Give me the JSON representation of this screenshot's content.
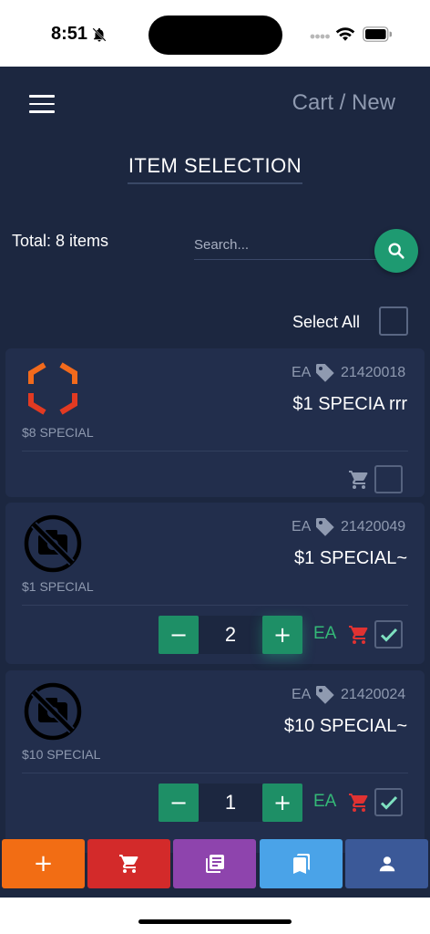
{
  "status_bar": {
    "time": "8:51"
  },
  "header": {
    "breadcrumb": "Cart / New",
    "title": "ITEM SELECTION"
  },
  "toolbar": {
    "total_text": "Total: 8 items",
    "search_placeholder": "Search...",
    "select_all_label": "Select All"
  },
  "items": [
    {
      "sub_label": "$8 SPECIAL",
      "uom": "EA",
      "sku": "21420018",
      "name": "$1 SPECIA rrr",
      "selected": false
    },
    {
      "sub_label": "$1 SPECIAL",
      "uom": "EA",
      "sku": "21420049",
      "name": "$1 SPECIAL~",
      "selected": true,
      "quantity": "2",
      "qty_uom": "EA",
      "minus_label": "−",
      "plus_label": "+"
    },
    {
      "sub_label": "$10 SPECIAL",
      "uom": "EA",
      "sku": "21420024",
      "name": "$10 SPECIAL~",
      "selected": true,
      "quantity": "1",
      "qty_uom": "EA",
      "minus_label": "−",
      "plus_label": "+"
    }
  ],
  "bottom_nav": {
    "add_label": "+"
  },
  "colors": {
    "background": "#1c2740",
    "card": "#222e4c",
    "accent_green": "#1e8f66",
    "nav_orange": "#f26d14",
    "nav_red": "#d32a2a",
    "nav_purple": "#8e44ad",
    "nav_blue": "#4aa3e8",
    "nav_indigo": "#3b5998"
  },
  "icons": [
    "menu-icon",
    "search-icon",
    "tag-icon",
    "cart-icon",
    "check-icon",
    "no-photo-icon",
    "brand-logo",
    "plus-icon",
    "library-icon",
    "bookmarks-icon",
    "person-icon"
  ]
}
